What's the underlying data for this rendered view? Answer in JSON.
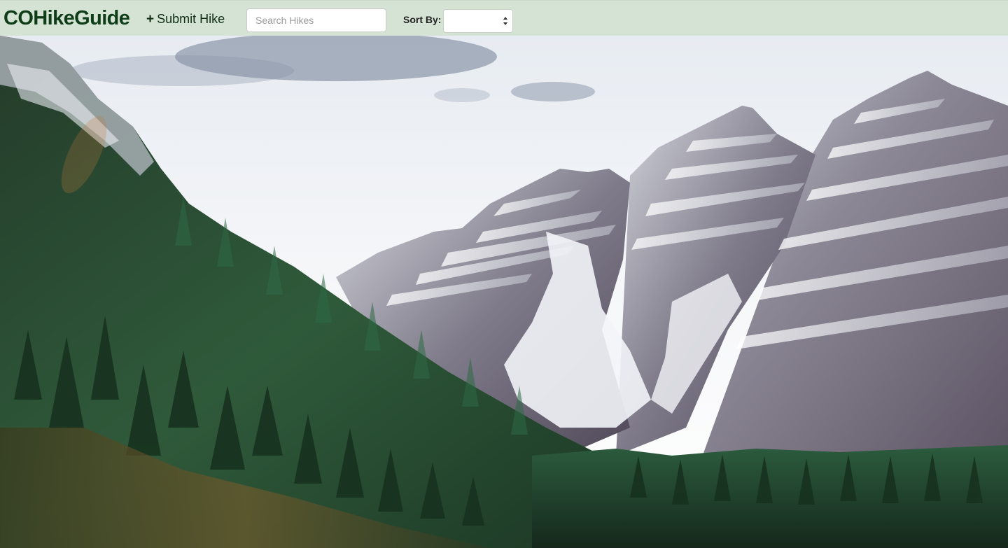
{
  "navbar": {
    "brand": "COHikeGuide",
    "submit_label": "Submit Hike",
    "submit_icon": "plus-icon",
    "search": {
      "placeholder": "Search Hikes",
      "value": ""
    },
    "sort": {
      "label": "Sort By:",
      "selected": ""
    }
  },
  "hero": {
    "image_icon": "mountain-landscape-image"
  },
  "colors": {
    "navbar_bg": "#d5e3d5",
    "brand_text": "#0f3d18"
  }
}
